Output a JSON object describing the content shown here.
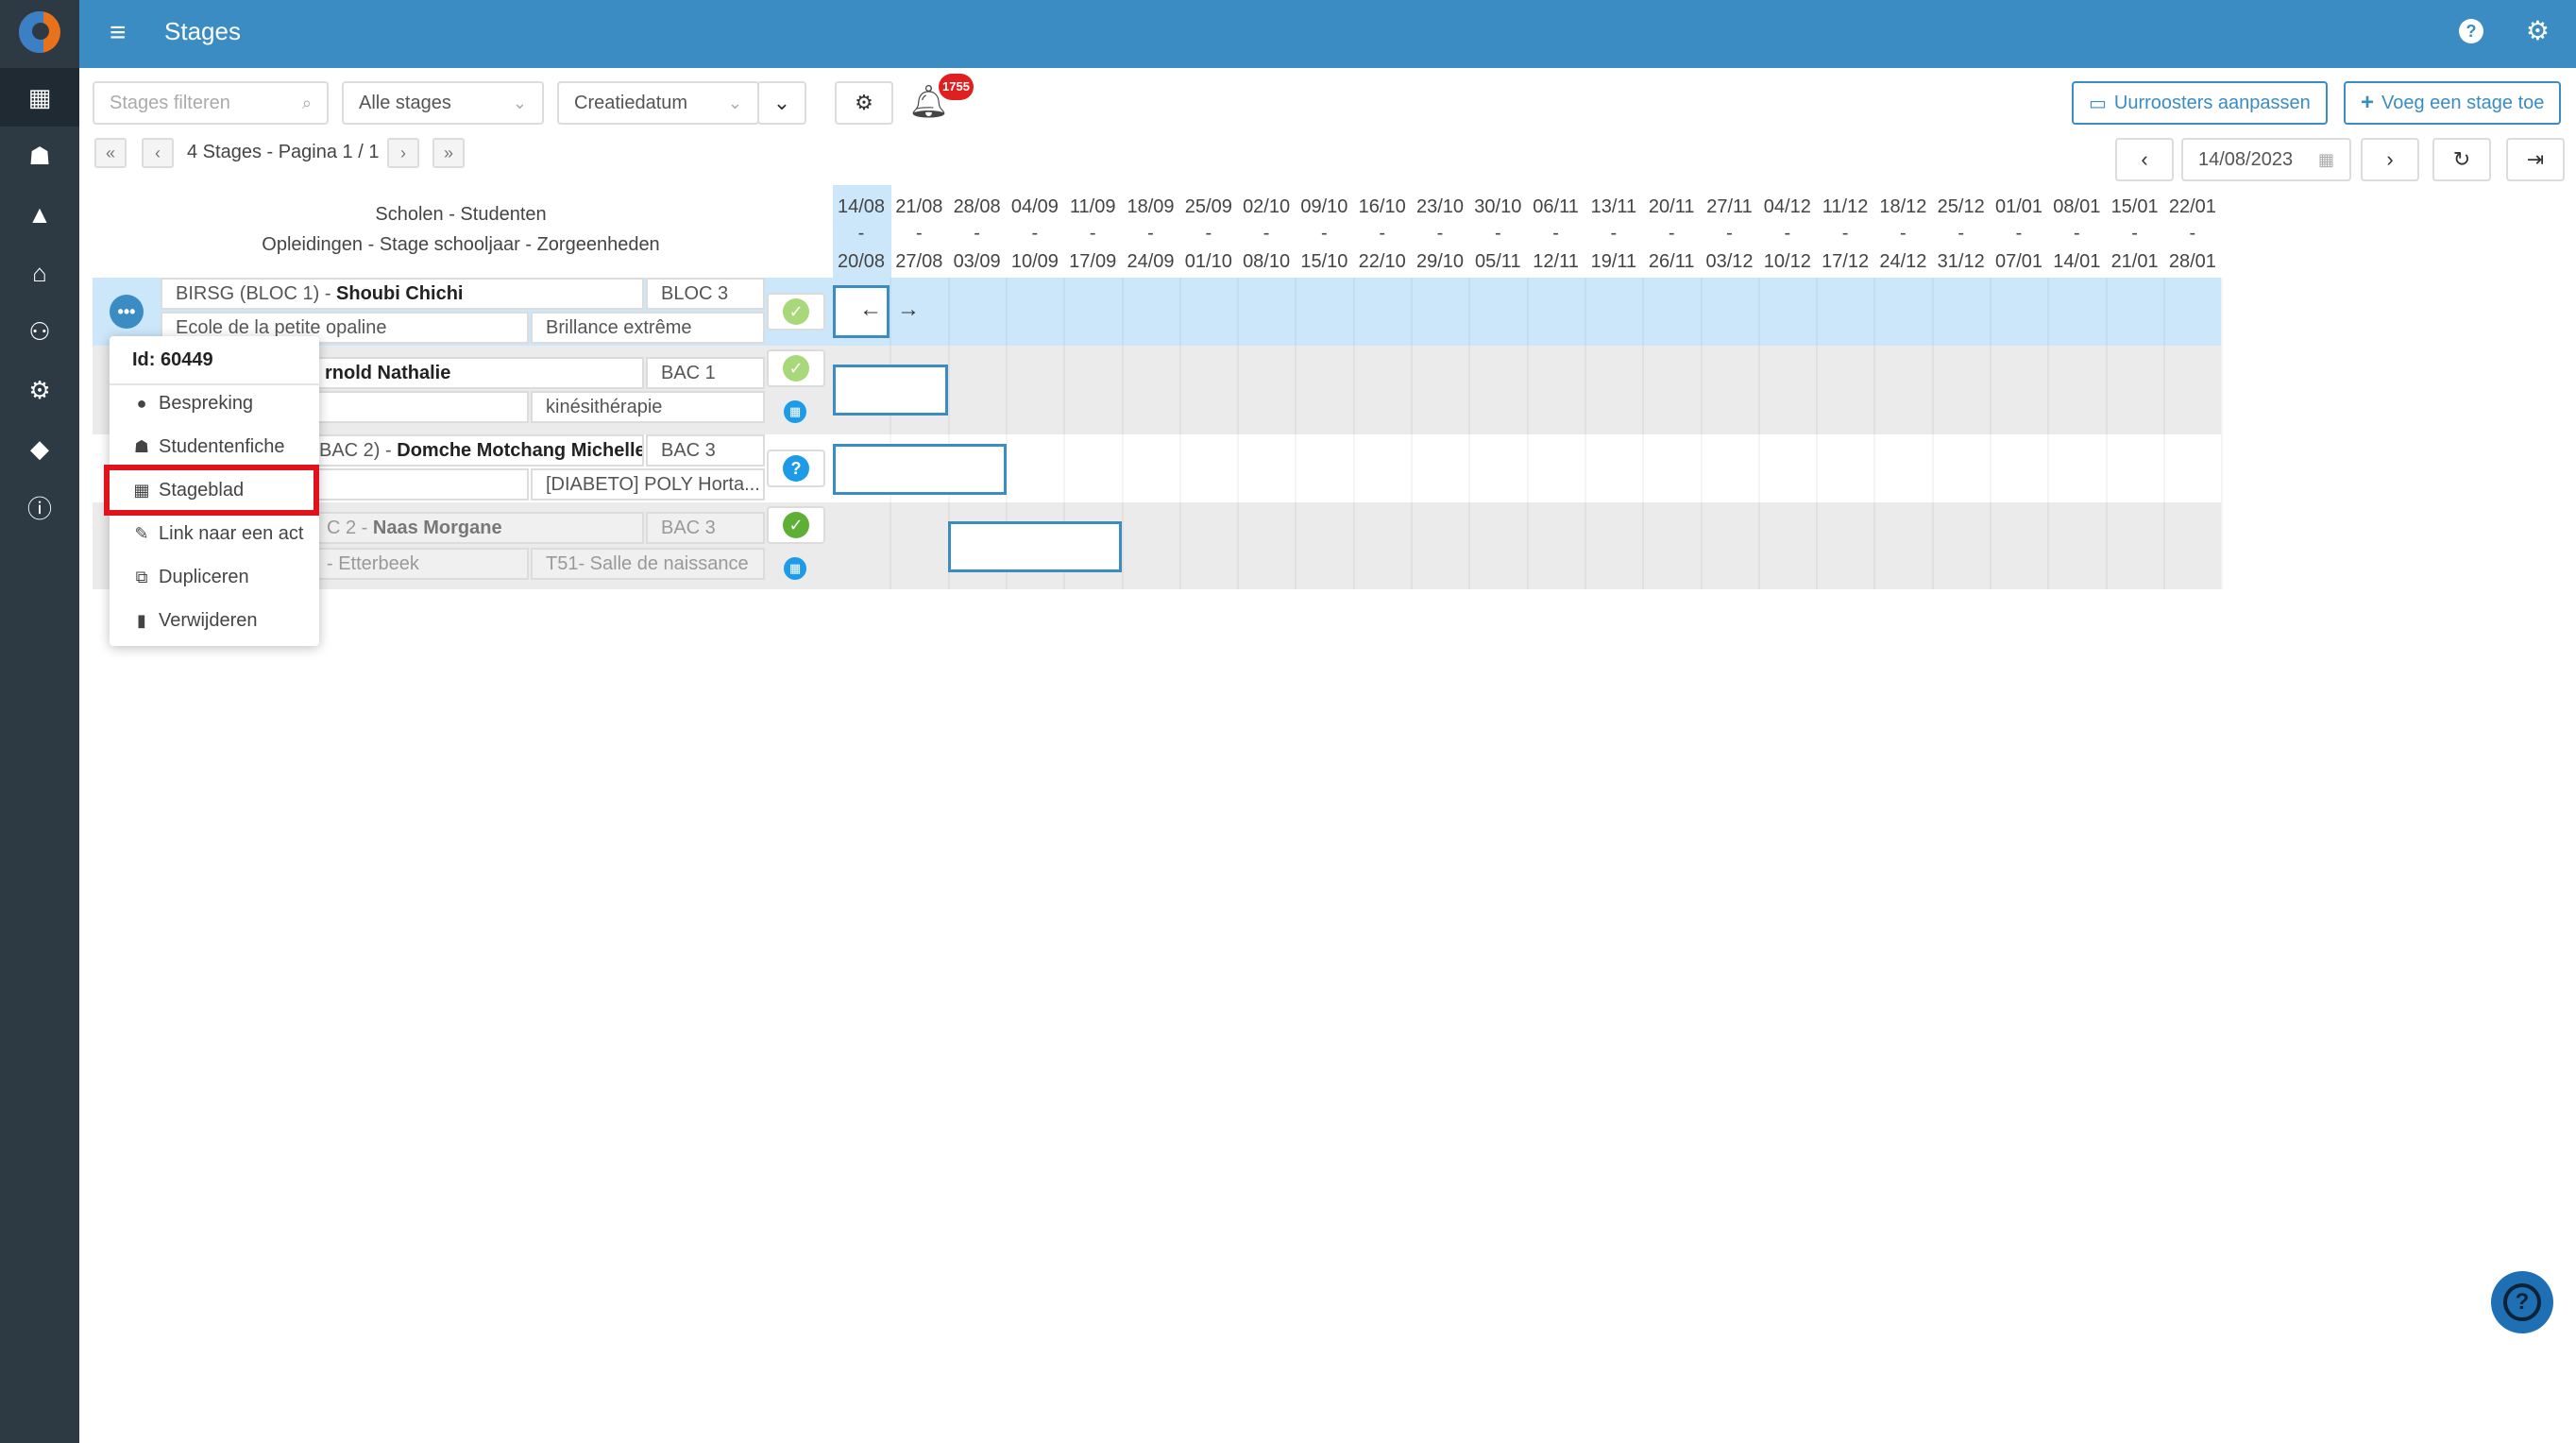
{
  "app": {
    "title": "Stages"
  },
  "sidebar": {
    "items": [
      {
        "icon": "calendar-icon",
        "glyph": "▦"
      },
      {
        "icon": "student-icon",
        "glyph": "☗"
      },
      {
        "icon": "graduation-cap-icon",
        "glyph": "🎓"
      },
      {
        "icon": "home-icon",
        "glyph": "⌂"
      },
      {
        "icon": "users-icon",
        "glyph": "⚇"
      },
      {
        "icon": "cogs-icon",
        "glyph": "⚙"
      },
      {
        "icon": "tags-icon",
        "glyph": "🏷"
      },
      {
        "icon": "info-icon",
        "glyph": "ℹ"
      }
    ]
  },
  "toolbar": {
    "filter_placeholder": "Stages filteren",
    "stage_select": "Alle stages",
    "sort_select": "Creatiedatum",
    "notification_count": "1755",
    "schedule_button": "Uurroosters aanpassen",
    "add_button": "Voeg een stage toe",
    "date_value": "14/08/2023"
  },
  "pager": {
    "text": "4 Stages - Pagina 1 / 1"
  },
  "timeline": {
    "header_line1": "Scholen - Studenten",
    "header_line2": "Opleidingen - Stage schooljaar - Zorgeenheden",
    "weeks": [
      {
        "start": "14/08",
        "end": "20/08"
      },
      {
        "start": "21/08",
        "end": "27/08"
      },
      {
        "start": "28/08",
        "end": "03/09"
      },
      {
        "start": "04/09",
        "end": "10/09"
      },
      {
        "start": "11/09",
        "end": "17/09"
      },
      {
        "start": "18/09",
        "end": "24/09"
      },
      {
        "start": "25/09",
        "end": "01/10"
      },
      {
        "start": "02/10",
        "end": "08/10"
      },
      {
        "start": "09/10",
        "end": "15/10"
      },
      {
        "start": "16/10",
        "end": "22/10"
      },
      {
        "start": "23/10",
        "end": "29/10"
      },
      {
        "start": "30/10",
        "end": "05/11"
      },
      {
        "start": "06/11",
        "end": "12/11"
      },
      {
        "start": "13/11",
        "end": "19/11"
      },
      {
        "start": "20/11",
        "end": "26/11"
      },
      {
        "start": "27/11",
        "end": "03/12"
      },
      {
        "start": "04/12",
        "end": "10/12"
      },
      {
        "start": "11/12",
        "end": "17/12"
      },
      {
        "start": "18/12",
        "end": "24/12"
      },
      {
        "start": "25/12",
        "end": "31/12"
      },
      {
        "start": "01/01",
        "end": "07/01"
      },
      {
        "start": "08/01",
        "end": "14/01"
      },
      {
        "start": "15/01",
        "end": "21/01"
      },
      {
        "start": "22/01",
        "end": "28/01"
      }
    ],
    "separator": "-"
  },
  "rows": [
    {
      "school_prefix": "BIRSG (BLOC 1) - ",
      "student": "Shoubi Chichi",
      "level": "BLOC 3",
      "place": "Ecole de la petite opaline",
      "unit": "Brillance extrême",
      "status": "approved"
    },
    {
      "school_prefix": "",
      "student": "rnold Nathalie",
      "level": "BAC 1",
      "place": "",
      "unit": "kinésithérapie",
      "status": "approved"
    },
    {
      "school_prefix": "BAC 2) - ",
      "student": "Domche Motchang Michelle",
      "level": "BAC 3",
      "place": "",
      "unit": "[DIABETO] POLY Horta...",
      "status": "question"
    },
    {
      "school_prefix": "C 2 - ",
      "student": "Naas Morgane",
      "level": "BAC 3",
      "place": "- Etterbeek",
      "unit": "T51- Salle de naissance",
      "status": "done"
    }
  ],
  "context_menu": {
    "id_label": "Id: 60449",
    "items": [
      {
        "label": "Bespreking",
        "icon": "comment-icon",
        "glyph": "💬"
      },
      {
        "label": "Studentenfiche",
        "icon": "student-icon",
        "glyph": "☗"
      },
      {
        "label": "Stageblad",
        "icon": "calendar-icon",
        "glyph": "▦"
      },
      {
        "label": "Link naar een act",
        "icon": "link-icon",
        "glyph": "✎"
      },
      {
        "label": "Dupliceren",
        "icon": "copy-icon",
        "glyph": "⧉"
      },
      {
        "label": "Verwijderen",
        "icon": "trash-icon",
        "glyph": "🗑"
      }
    ]
  },
  "colors": {
    "primary": "#3a8cc3",
    "sidebar": "#2d3a44",
    "highlight": "#e0131c",
    "approved": "#a8d87a",
    "question": "#1e9be8",
    "done": "#5db035"
  }
}
